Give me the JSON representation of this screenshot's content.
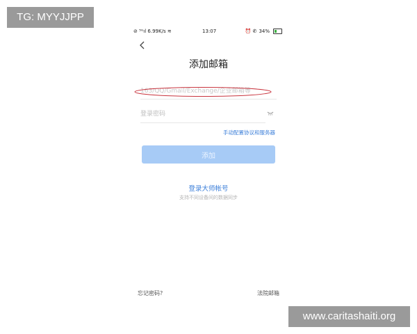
{
  "watermarks": {
    "top_left": "TG: MYYJJPP",
    "bottom_right": "www.caritashaiti.org"
  },
  "status_bar": {
    "left": "⊘ ⁵ᴳıl 6.99K/s ≋",
    "time": "13:07",
    "right_icons": "⏰ ✆",
    "battery": "34%",
    "battery_level": 0.34,
    "battery_color": "#3cb043"
  },
  "header": {
    "back_icon": "chevron-left-icon",
    "title": "添加邮箱"
  },
  "form": {
    "email_placeholder": "163/QQ/Gmail/Exchange/企业邮箱等",
    "password_placeholder": "登录密码",
    "eye_icon": "eye-closed-icon",
    "manual_config_label": "手动配置协议和服务器",
    "add_label": "添加"
  },
  "master": {
    "link_label": "登录大师帐号",
    "subtitle": "支持不同设备间的数据同步"
  },
  "footer": {
    "forgot_label": "忘记密码?",
    "law_label": "法院邮箱"
  },
  "colors": {
    "accent": "#3c7fd9",
    "button_disabled": "#a7cbf6",
    "annotation": "#c8323c"
  }
}
